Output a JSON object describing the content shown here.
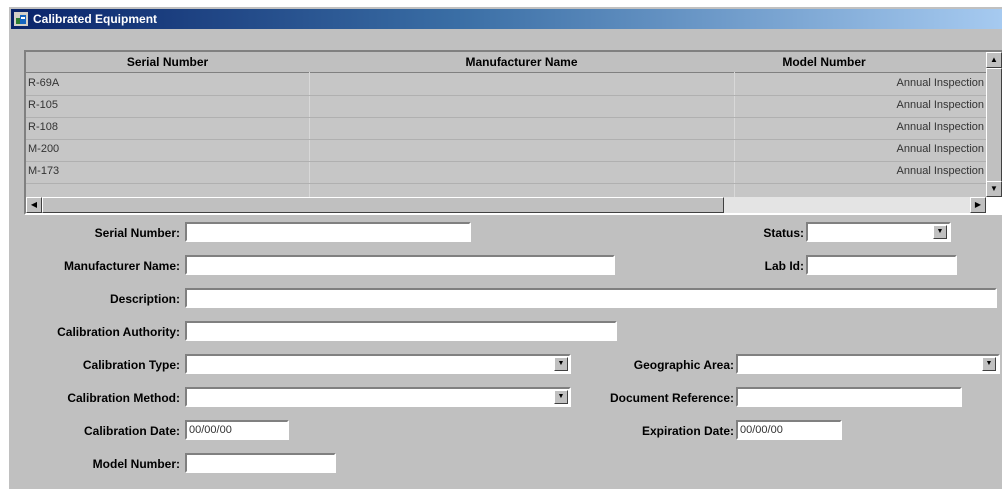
{
  "window": {
    "title": "Calibrated Equipment"
  },
  "grid": {
    "columns": [
      "Serial Number",
      "Manufacturer Name",
      "Model Number"
    ],
    "rows": [
      {
        "serial": "R-69A",
        "type": "Annual Inspection"
      },
      {
        "serial": "R-105",
        "type": "Annual Inspection"
      },
      {
        "serial": "R-108",
        "type": "Annual Inspection"
      },
      {
        "serial": "M-200",
        "type": "Annual Inspection"
      },
      {
        "serial": "M-173",
        "type": "Annual Inspection"
      }
    ]
  },
  "form": {
    "serial_number": {
      "label": "Serial Number:",
      "value": ""
    },
    "status": {
      "label": "Status:",
      "value": ""
    },
    "manufacturer_name": {
      "label": "Manufacturer Name:",
      "value": ""
    },
    "lab_id": {
      "label": "Lab Id:",
      "value": ""
    },
    "description": {
      "label": "Description:",
      "value": ""
    },
    "calibration_authority": {
      "label": "Calibration Authority:",
      "value": ""
    },
    "calibration_type": {
      "label": "Calibration Type:",
      "value": ""
    },
    "geographic_area": {
      "label": "Geographic Area:",
      "value": ""
    },
    "calibration_method": {
      "label": "Calibration Method:",
      "value": ""
    },
    "document_reference": {
      "label": "Document Reference:",
      "value": ""
    },
    "calibration_date": {
      "label": "Calibration Date:",
      "value": "00/00/00"
    },
    "expiration_date": {
      "label": "Expiration Date:",
      "value": "00/00/00"
    },
    "model_number": {
      "label": "Model Number:",
      "value": ""
    }
  }
}
